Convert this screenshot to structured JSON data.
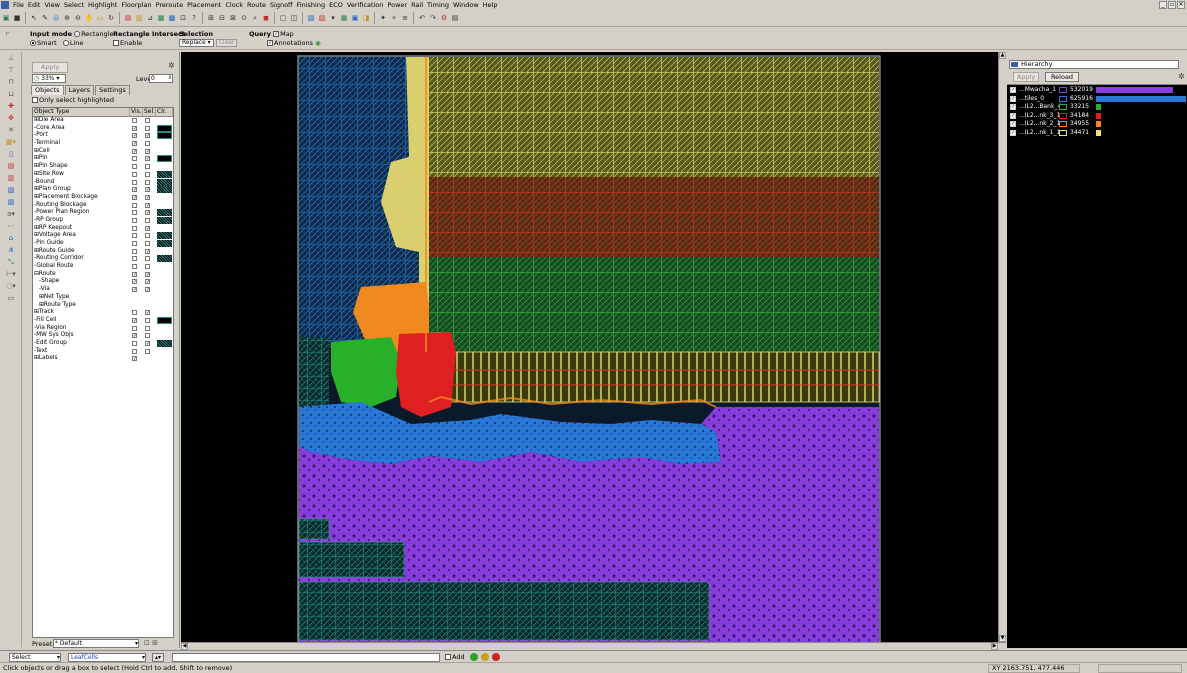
{
  "menubar": {
    "items": [
      "File",
      "Edit",
      "View",
      "Select",
      "Highlight",
      "Floorplan",
      "Preroute",
      "Placement",
      "Clock",
      "Route",
      "Signoff",
      "Finishing",
      "ECO",
      "Verification",
      "Power",
      "Rail",
      "Timing",
      "Window",
      "Help"
    ],
    "window_controls": [
      "_",
      "▫",
      "✕"
    ]
  },
  "input_bar": {
    "input_mode_label": "Input mode",
    "rectangle_label": "Rectangle",
    "smart_label": "Smart",
    "line_label": "Line",
    "rect_intersect_label": "Rectangle Intersect",
    "enable_label": "Enable",
    "selection_label": "Selection",
    "selection_value": "Replace",
    "clear_label": "Clear",
    "query_label": "Query",
    "map_label": "Map",
    "annotations_label": "Annotations"
  },
  "left_panel": {
    "apply_label": "Apply",
    "zoom_value": "33%",
    "level_label": "Level",
    "level_value": "0",
    "tabs": [
      {
        "label": "Objects",
        "active": true
      },
      {
        "label": "Layers",
        "active": false
      },
      {
        "label": "Settings",
        "active": false
      }
    ],
    "only_highlighted_label": "Only select highlighted",
    "table_headers": {
      "type": "Object Type",
      "vis": "Vis.",
      "sel": "Sel.",
      "clr": "Clr."
    },
    "rows": [
      {
        "label": "Die Area",
        "prefix": "⊞",
        "indent": 0,
        "vis": false,
        "sel": false,
        "swatch": false
      },
      {
        "label": "Core Area",
        "prefix": "-",
        "indent": 0,
        "vis": true,
        "sel": false,
        "swatch": "solid"
      },
      {
        "label": "Port",
        "prefix": "-",
        "indent": 0,
        "vis": true,
        "sel": true,
        "swatch": "solid"
      },
      {
        "label": "Terminal",
        "prefix": "-",
        "indent": 0,
        "vis": true,
        "sel": false,
        "swatch": false
      },
      {
        "label": "Cell",
        "prefix": "⊞",
        "indent": 0,
        "vis": true,
        "sel": true,
        "swatch": false
      },
      {
        "label": "Pin",
        "prefix": "⊞",
        "indent": 0,
        "vis": false,
        "sel": true,
        "swatch": "solid"
      },
      {
        "label": "Pin Shape",
        "prefix": "⊞",
        "indent": 0,
        "vis": false,
        "sel": false,
        "swatch": false
      },
      {
        "label": "Site Row",
        "prefix": "⊞",
        "indent": 0,
        "vis": false,
        "sel": false,
        "swatch": "pattern"
      },
      {
        "label": "Bound",
        "prefix": "-",
        "indent": 0,
        "vis": false,
        "sel": false,
        "swatch": "pattern"
      },
      {
        "label": "Plan Group",
        "prefix": "⊞",
        "indent": 0,
        "vis": true,
        "sel": true,
        "swatch": "pattern"
      },
      {
        "label": "Placement Blockage",
        "prefix": "⊞",
        "indent": 0,
        "vis": true,
        "sel": true,
        "swatch": false
      },
      {
        "label": "Routing Blockage",
        "prefix": "-",
        "indent": 0,
        "vis": false,
        "sel": true,
        "swatch": false
      },
      {
        "label": "Power Plan Region",
        "prefix": "-",
        "indent": 0,
        "vis": false,
        "sel": true,
        "swatch": "pattern"
      },
      {
        "label": "RP Group",
        "prefix": "-",
        "indent": 0,
        "vis": false,
        "sel": false,
        "swatch": "pattern"
      },
      {
        "label": "RP Keepout",
        "prefix": "⊞",
        "indent": 0,
        "vis": false,
        "sel": true,
        "swatch": false
      },
      {
        "label": "Voltage Area",
        "prefix": "⊞",
        "indent": 0,
        "vis": false,
        "sel": false,
        "swatch": "pattern"
      },
      {
        "label": "Pin Guide",
        "prefix": "-",
        "indent": 0,
        "vis": false,
        "sel": false,
        "swatch": "pattern"
      },
      {
        "label": "Route Guide",
        "prefix": "⊞",
        "indent": 0,
        "vis": false,
        "sel": true,
        "swatch": false
      },
      {
        "label": "Routing Corridor",
        "prefix": "-",
        "indent": 0,
        "vis": false,
        "sel": false,
        "swatch": "pattern"
      },
      {
        "label": "Global Route",
        "prefix": "-",
        "indent": 0,
        "vis": false,
        "sel": false,
        "swatch": false
      },
      {
        "label": "Route",
        "prefix": "⊟",
        "indent": 0,
        "vis": true,
        "sel": true,
        "swatch": false
      },
      {
        "label": "Shape",
        "prefix": "-",
        "indent": 1,
        "vis": true,
        "sel": true,
        "swatch": false
      },
      {
        "label": "Via",
        "prefix": "-",
        "indent": 1,
        "vis": true,
        "sel": true,
        "swatch": false
      },
      {
        "label": "Net Type",
        "prefix": "⊞",
        "indent": 1,
        "vis": null,
        "sel": null,
        "swatch": false
      },
      {
        "label": "Route Type",
        "prefix": "⊞",
        "indent": 1,
        "vis": null,
        "sel": null,
        "swatch": false
      },
      {
        "label": "Track",
        "prefix": "⊞",
        "indent": 0,
        "vis": false,
        "sel": true,
        "swatch": false
      },
      {
        "label": "Fill Cell",
        "prefix": "-",
        "indent": 0,
        "vis": true,
        "sel": false,
        "swatch": "solid"
      },
      {
        "label": "Via Region",
        "prefix": "-",
        "indent": 0,
        "vis": false,
        "sel": false,
        "swatch": false
      },
      {
        "label": "MW Sys Objs",
        "prefix": "-",
        "indent": 0,
        "vis": true,
        "sel": false,
        "swatch": false
      },
      {
        "label": "Edit Group",
        "prefix": "-",
        "indent": 0,
        "vis": false,
        "sel": true,
        "swatch": "pattern"
      },
      {
        "label": "Text",
        "prefix": "-",
        "indent": 0,
        "vis": false,
        "sel": false,
        "swatch": false
      },
      {
        "label": "Labels",
        "prefix": "⊞",
        "indent": 0,
        "vis": true,
        "sel": null,
        "swatch": false
      }
    ],
    "preset_label": "Preset",
    "preset_value": "* Default"
  },
  "hierarchy": {
    "title": "Hierarchy",
    "apply_label": "Apply",
    "reload_label": "Reload",
    "rows": [
      {
        "name": "...Mwacha_1",
        "count": "532019",
        "color": "#8a3ee0",
        "bar_fraction": 0.85
      },
      {
        "name": "...tiles_0",
        "count": "625916",
        "color": "#2a78d8",
        "bar_fraction": 1.0
      },
      {
        "name": "...IL2...Bank_4",
        "count": "33215",
        "color": "#28b028",
        "bar_fraction": 0.053
      },
      {
        "name": "...IL2...nk_3_1",
        "count": "34184",
        "color": "#e02020",
        "bar_fraction": 0.055
      },
      {
        "name": "...IL2...nk_2_1",
        "count": "34955",
        "color": "#f08a20",
        "bar_fraction": 0.056
      },
      {
        "name": "...IL2...nk_1_1",
        "count": "34471",
        "color": "#f0e070",
        "bar_fraction": 0.055
      }
    ]
  },
  "bottom_bar": {
    "mode_value": "Select",
    "filter_value": "LeafCells",
    "add_label": "Add"
  },
  "status": {
    "message": "Click objects or drag a box to select (Hold Ctrl to add, Shift to remove)",
    "coordinates": "XY 2163.751, 477.446"
  },
  "colors": {
    "purple": "#8a3ee0",
    "blue": "#2a78d8",
    "green": "#28b028",
    "red": "#e02020",
    "orange": "#f08a20",
    "yellow": "#f0e070"
  }
}
